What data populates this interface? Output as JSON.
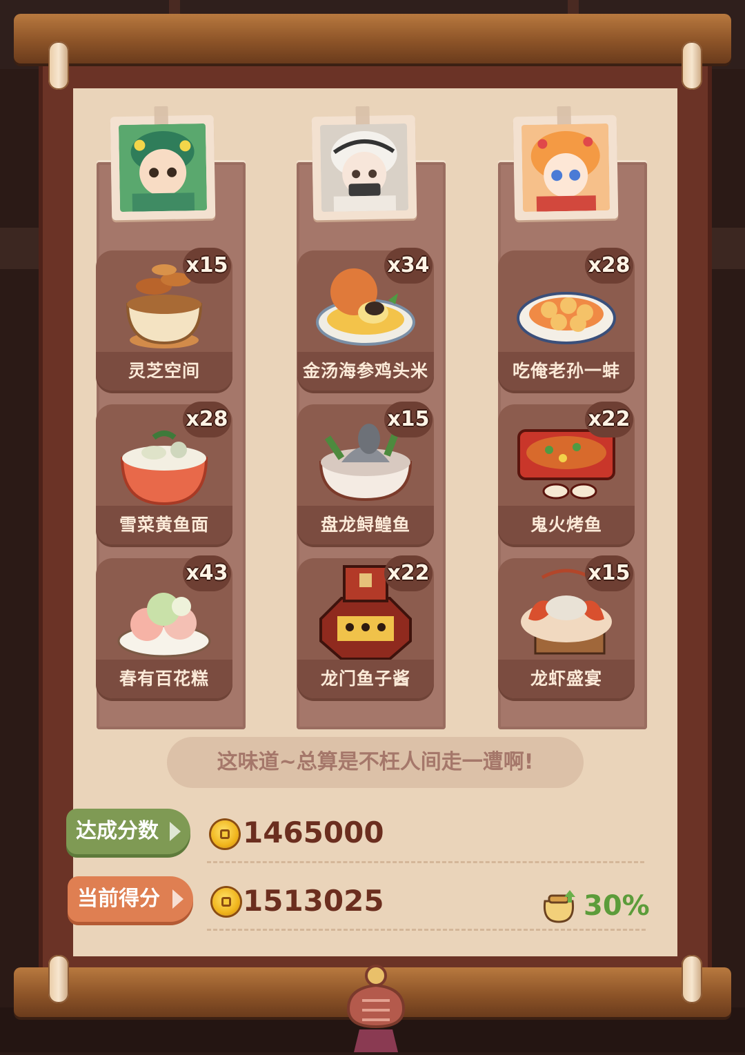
{
  "characters": [
    {
      "name": "character-1",
      "bg": "#4fa56b"
    },
    {
      "name": "character-2",
      "bg": "#cfc6bd"
    },
    {
      "name": "character-3",
      "bg": "#f39a52"
    }
  ],
  "dishes": [
    [
      {
        "name": "灵芝空间",
        "count": "x15",
        "icon": "mushroom-pot-icon"
      },
      {
        "name": "雪菜黄鱼面",
        "count": "x28",
        "icon": "noodle-bowl-icon"
      },
      {
        "name": "春有百花糕",
        "count": "x43",
        "icon": "flower-cake-icon"
      }
    ],
    [
      {
        "name": "金汤海参鸡头米",
        "count": "x34",
        "icon": "golden-soup-icon"
      },
      {
        "name": "盘龙鲟鳇鱼",
        "count": "x15",
        "icon": "sturgeon-dish-icon"
      },
      {
        "name": "龙门鱼子酱",
        "count": "x22",
        "icon": "caviar-gate-icon"
      }
    ],
    [
      {
        "name": "吃俺老孙一蚌",
        "count": "x28",
        "icon": "clam-plate-icon"
      },
      {
        "name": "鬼火烤鱼",
        "count": "x22",
        "icon": "grilled-fish-icon"
      },
      {
        "name": "龙虾盛宴",
        "count": "x15",
        "icon": "lobster-feast-icon"
      }
    ]
  ],
  "quote": "这味道~总算是不枉人间走一遭啊!",
  "target": {
    "label": "达成分数",
    "value": "1465000",
    "color": "#7d9a52"
  },
  "current": {
    "label": "当前得分",
    "value": "1513025",
    "color": "#dd7c4f"
  },
  "bonus": {
    "value": "30%",
    "icon": "bonus-bag-icon"
  }
}
